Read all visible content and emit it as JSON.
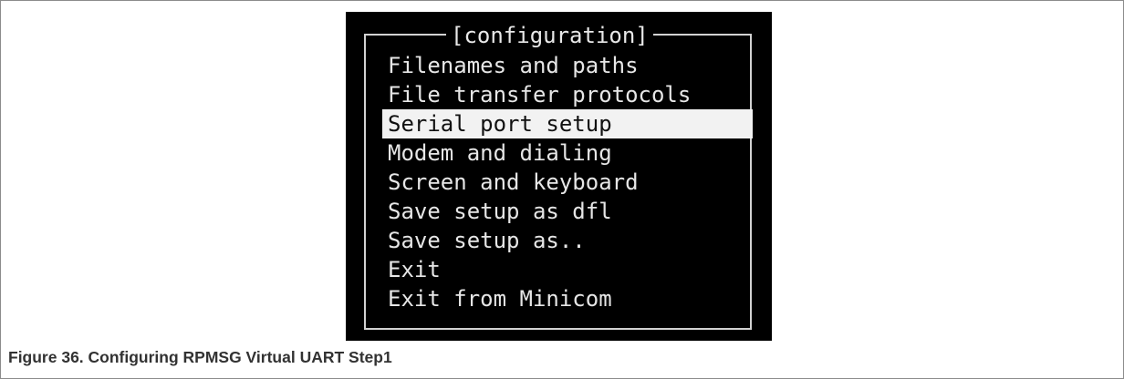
{
  "menu": {
    "title": "[configuration]",
    "items": [
      {
        "label": "Filenames and paths",
        "selected": false
      },
      {
        "label": "File transfer protocols",
        "selected": false
      },
      {
        "label": "Serial port setup",
        "selected": true
      },
      {
        "label": "Modem and dialing",
        "selected": false
      },
      {
        "label": "Screen and keyboard",
        "selected": false
      },
      {
        "label": "Save setup as dfl",
        "selected": false
      },
      {
        "label": "Save setup as..",
        "selected": false
      },
      {
        "label": "Exit",
        "selected": false
      },
      {
        "label": "Exit from Minicom",
        "selected": false
      }
    ]
  },
  "caption": {
    "text": "Figure 36.  Configuring RPMSG Virtual UART Step1"
  },
  "colors": {
    "terminal_bg": "#000000",
    "terminal_text": "#e6e6e6",
    "selection_bg": "#f2f2f2",
    "selection_text": "#111111",
    "caption_text": "#323232"
  }
}
